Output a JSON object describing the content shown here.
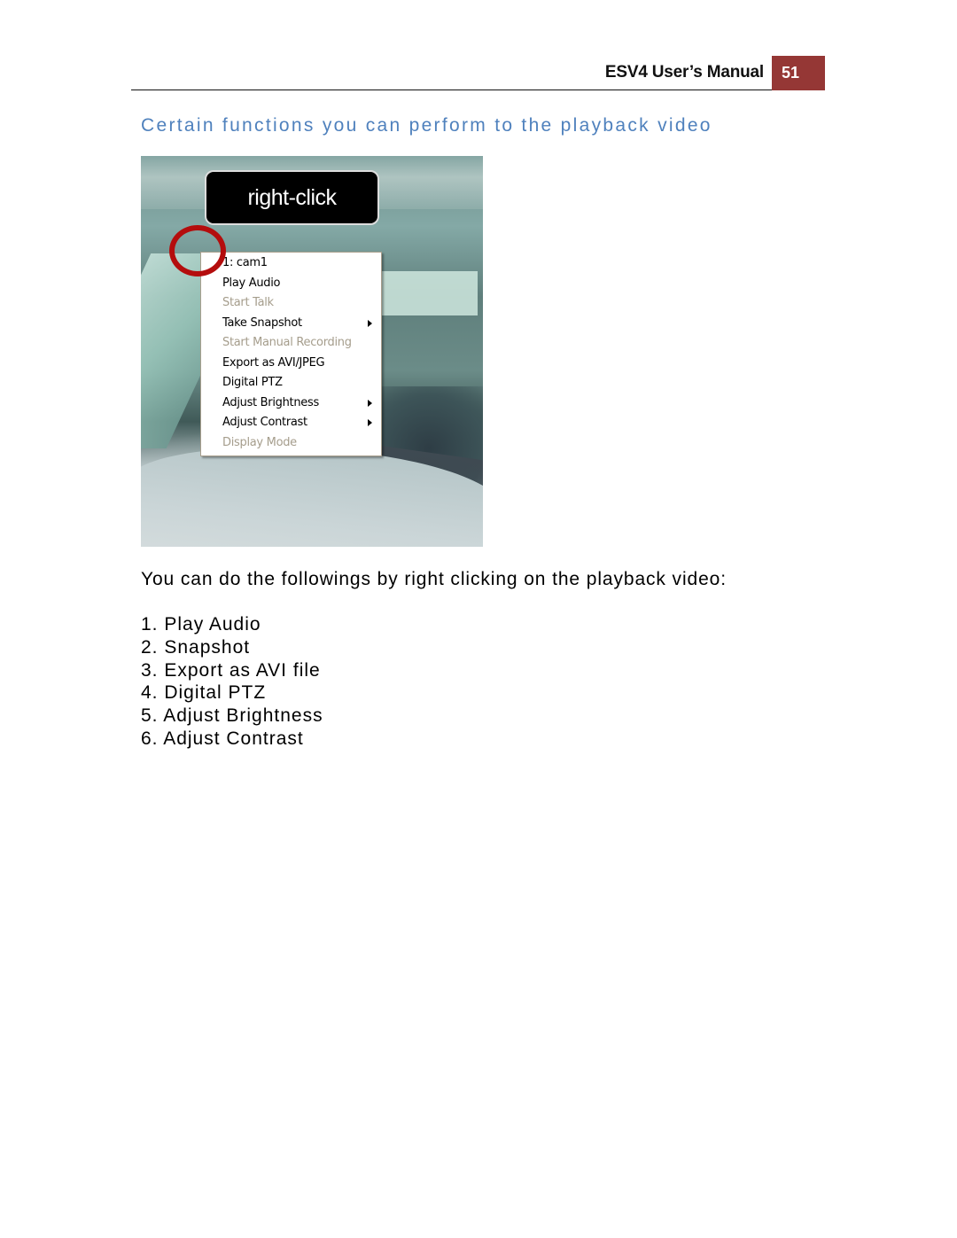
{
  "header": {
    "manual_title": "ESV4 User’s Manual",
    "page_number": "51"
  },
  "section_heading": "Certain functions you can perform to the playback video",
  "figure": {
    "callout_label": "right-click",
    "context_menu": {
      "items": [
        {
          "label": "1: cam1",
          "enabled": true,
          "submenu": false
        },
        {
          "label": "Play Audio",
          "enabled": true,
          "submenu": false
        },
        {
          "label": "Start Talk",
          "enabled": false,
          "submenu": false
        },
        {
          "label": "Take Snapshot",
          "enabled": true,
          "submenu": true
        },
        {
          "label": "Start Manual Recording",
          "enabled": false,
          "submenu": false
        },
        {
          "label": "Export as AVI/JPEG",
          "enabled": true,
          "submenu": false
        },
        {
          "label": "Digital PTZ",
          "enabled": true,
          "submenu": false
        },
        {
          "label": "Adjust Brightness",
          "enabled": true,
          "submenu": true
        },
        {
          "label": "Adjust Contrast",
          "enabled": true,
          "submenu": true
        },
        {
          "label": "Display Mode",
          "enabled": false,
          "submenu": false
        }
      ]
    }
  },
  "intro_text": "You can do the followings by right clicking on the playback video:",
  "steps": [
    "1. Play Audio",
    "2. Snapshot",
    "3. Export as AVI file",
    "4. Digital PTZ",
    "5. Adjust Brightness",
    "6. Adjust Contrast"
  ],
  "colors": {
    "heading_blue": "#4f81bd",
    "page_badge_red": "#953735",
    "ring_red": "#b40d0d",
    "menu_disabled": "#a59d8c"
  }
}
